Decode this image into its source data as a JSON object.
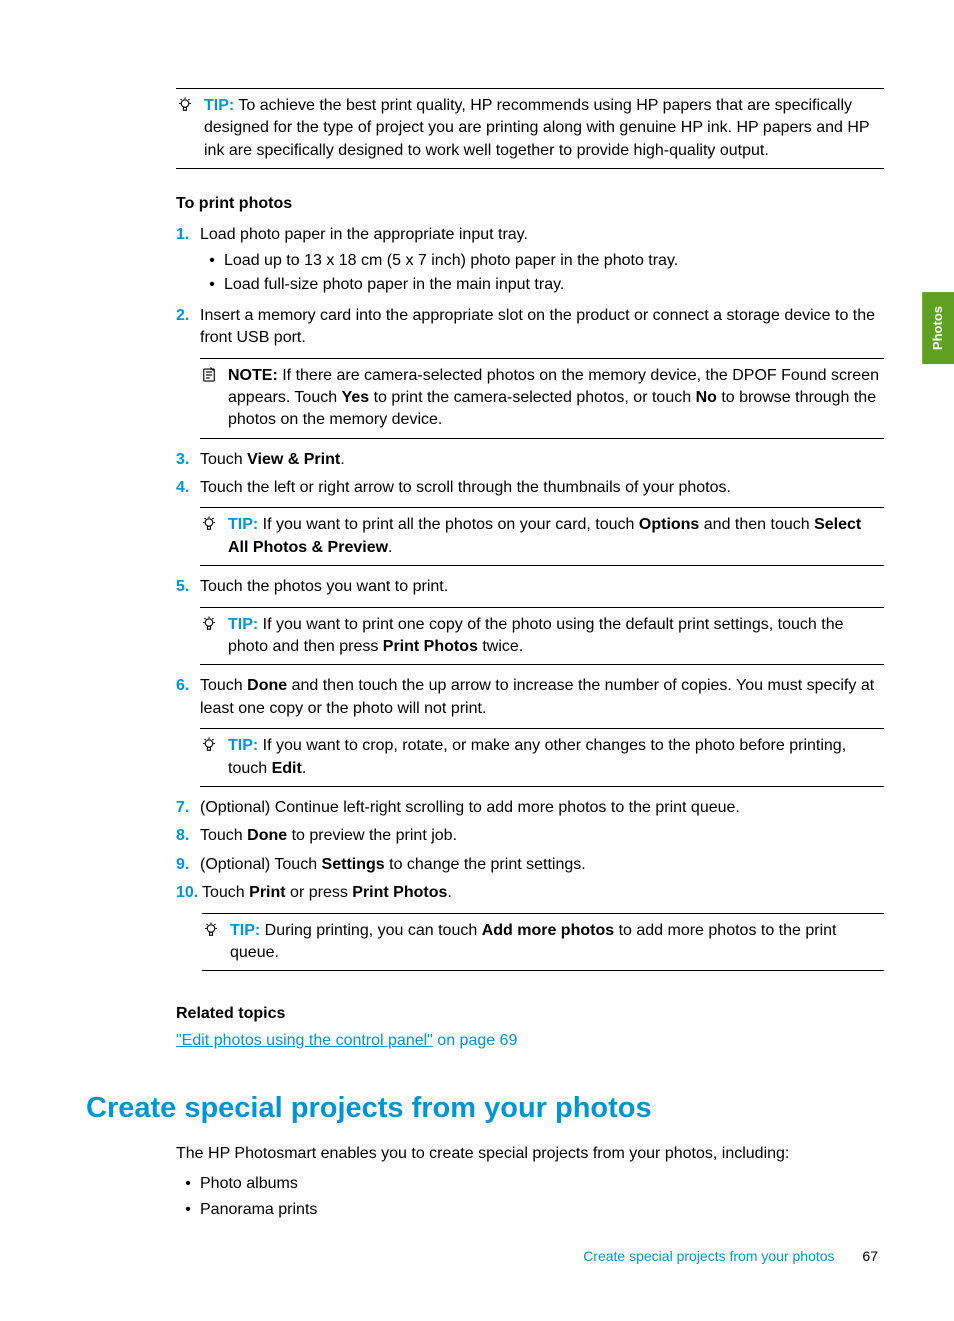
{
  "sideTab": "Photos",
  "tip1": {
    "label": "TIP:",
    "text": "To achieve the best print quality, HP recommends using HP papers that are specifically designed for the type of project you are printing along with genuine HP ink. HP papers and HP ink are specifically designed to work well together to provide high-quality output."
  },
  "procedureTitle": "To print photos",
  "steps": {
    "s1": {
      "num": "1.",
      "text": "Load photo paper in the appropriate input tray.",
      "sub1": "Load up to 13 x 18 cm (5 x 7 inch) photo paper in the photo tray.",
      "sub2": "Load full-size photo paper in the main input tray."
    },
    "s2": {
      "num": "2.",
      "text": "Insert a memory card into the appropriate slot on the product or connect a storage device to the front USB port.",
      "note": {
        "label": "NOTE:",
        "t1": "If there are camera-selected photos on the memory device, the DPOF Found screen appears. Touch ",
        "b1": "Yes",
        "t2": " to print the camera-selected photos, or touch ",
        "b2": "No",
        "t3": " to browse through the photos on the memory device."
      }
    },
    "s3": {
      "num": "3.",
      "t1": "Touch ",
      "b1": "View & Print",
      "t2": "."
    },
    "s4": {
      "num": "4.",
      "text": "Touch the left or right arrow to scroll through the thumbnails of your photos.",
      "tip": {
        "label": "TIP:",
        "t1": "If you want to print all the photos on your card, touch ",
        "b1": "Options",
        "t2": " and then touch ",
        "b2": "Select All Photos & Preview",
        "t3": "."
      }
    },
    "s5": {
      "num": "5.",
      "text": "Touch the photos you want to print.",
      "tip": {
        "label": "TIP:",
        "t1": "If you want to print one copy of the photo using the default print settings, touch the photo and then press ",
        "b1": "Print Photos",
        "t2": " twice."
      }
    },
    "s6": {
      "num": "6.",
      "t1": "Touch ",
      "b1": "Done",
      "t2": " and then touch the up arrow to increase the number of copies. You must specify at least one copy or the photo will not print.",
      "tip": {
        "label": "TIP:",
        "t1": "If you want to crop, rotate, or make any other changes to the photo before printing, touch ",
        "b1": "Edit",
        "t2": "."
      }
    },
    "s7": {
      "num": "7.",
      "text": "(Optional) Continue left-right scrolling to add more photos to the print queue."
    },
    "s8": {
      "num": "8.",
      "t1": "Touch ",
      "b1": "Done",
      "t2": " to preview the print job."
    },
    "s9": {
      "num": "9.",
      "t1": "(Optional) Touch ",
      "b1": "Settings",
      "t2": " to change the print settings."
    },
    "s10": {
      "num": "10.",
      "t1": "Touch ",
      "b1": "Print",
      "t2": " or press ",
      "b2": "Print Photos",
      "t3": ".",
      "tip": {
        "label": "TIP:",
        "t1": "During printing, you can touch ",
        "b1": "Add more photos",
        "t2": " to add more photos to the print queue."
      }
    }
  },
  "relatedHeading": "Related topics",
  "relatedLink": "\"Edit photos using the control panel\"",
  "relatedSuffix": " on page 69",
  "mainHeading": "Create special projects from your photos",
  "introText": "The HP Photosmart enables you to create special projects from your photos, including:",
  "bullets": {
    "b1": "Photo albums",
    "b2": "Panorama prints"
  },
  "footer": {
    "title": "Create special projects from your photos",
    "page": "67"
  }
}
